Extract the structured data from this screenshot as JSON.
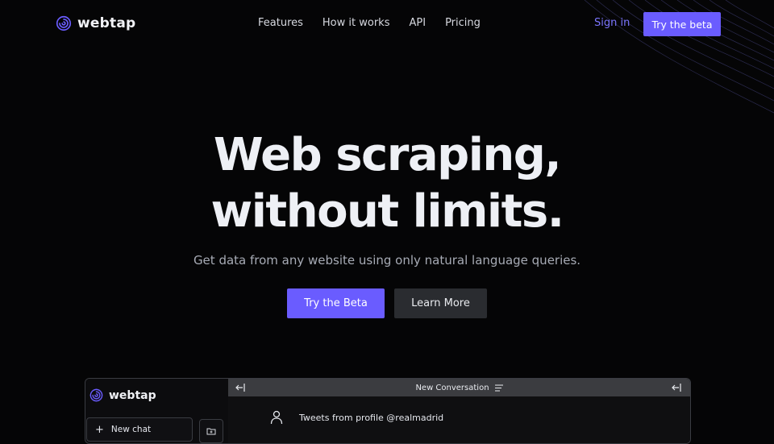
{
  "brand": {
    "name": "webtap",
    "accent": "#6a5cff"
  },
  "nav": {
    "links": [
      "Features",
      "How it works",
      "API",
      "Pricing"
    ],
    "sign_in": "Sign in",
    "cta": "Try the beta"
  },
  "hero": {
    "title_line1": "Web scraping,",
    "title_line2": "without limits.",
    "subtitle": "Get data from any website using only natural language queries.",
    "primary_cta": "Try the Beta",
    "secondary_cta": "Learn More"
  },
  "app_preview": {
    "brand": "webtap",
    "new_chat": "New chat",
    "conversation_title": "New Conversation",
    "message": "Tweets from profile @realmadrid",
    "icons": [
      "plus-icon",
      "folder-icon",
      "collapse-left-icon",
      "menu-icon",
      "user-icon"
    ]
  }
}
